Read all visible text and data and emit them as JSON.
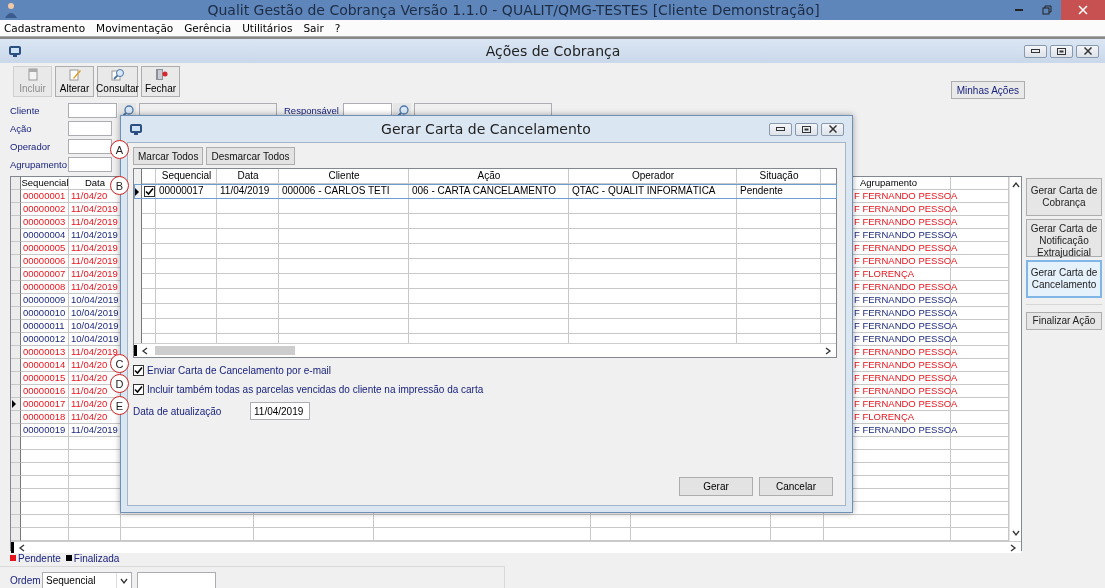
{
  "app": {
    "title": "Qualit Gestão de Cobrança Versão 1.1.0 - QUALIT/QMG-TESTES [Cliente Demonstração]"
  },
  "menu": [
    "Cadastramento",
    "Movimentação",
    "Gerência",
    "Utilitários",
    "Sair",
    "?"
  ],
  "window": {
    "title": "Ações de Cobrança"
  },
  "toolbar": [
    {
      "kind": "new",
      "label": "Incluir",
      "disabled": true
    },
    {
      "kind": "edit",
      "label": "Alterar",
      "disabled": false
    },
    {
      "kind": "search",
      "label": "Consultar",
      "disabled": false
    },
    {
      "kind": "close",
      "label": "Fechar",
      "disabled": false
    }
  ],
  "my_actions_button": "Minhas Ações",
  "filters": [
    {
      "label": "Cliente",
      "kind": "lookup"
    },
    {
      "label": "Responsável",
      "kind": "lookup"
    },
    {
      "label": "Ação",
      "kind": "plain"
    },
    {
      "label": "Operador",
      "kind": "plain"
    },
    {
      "label": "Agrupamento",
      "kind": "plain"
    }
  ],
  "grid": {
    "columns": [
      "Sequencial",
      "Data"
    ],
    "column_agrupamento": "Agrupamento",
    "rows": [
      {
        "sequencial": "00000001",
        "data": "11/04/20",
        "agrupamento": "F FERNANDO PESSOA",
        "pending": true,
        "current": false
      },
      {
        "sequencial": "00000002",
        "data": "11/04/2019",
        "agrupamento": "F FERNANDO PESSOA",
        "pending": true,
        "current": false
      },
      {
        "sequencial": "00000003",
        "data": "11/04/2019",
        "agrupamento": "F FERNANDO PESSOA",
        "pending": true,
        "current": false
      },
      {
        "sequencial": "00000004",
        "data": "11/04/2019",
        "agrupamento": "F FERNANDO PESSOA",
        "pending": false,
        "current": false
      },
      {
        "sequencial": "00000005",
        "data": "11/04/2019",
        "agrupamento": "F FERNANDO PESSOA",
        "pending": true,
        "current": false
      },
      {
        "sequencial": "00000006",
        "data": "11/04/2019",
        "agrupamento": "F FERNANDO PESSOA",
        "pending": true,
        "current": false
      },
      {
        "sequencial": "00000007",
        "data": "11/04/2019",
        "agrupamento": "F FLORENÇA",
        "pending": true,
        "current": false
      },
      {
        "sequencial": "00000008",
        "data": "11/04/2019",
        "agrupamento": "F FERNANDO PESSOA",
        "pending": true,
        "current": false
      },
      {
        "sequencial": "00000009",
        "data": "10/04/2019",
        "agrupamento": "F FERNANDO PESSOA",
        "pending": false,
        "current": false
      },
      {
        "sequencial": "00000010",
        "data": "10/04/2019",
        "agrupamento": "F FERNANDO PESSOA",
        "pending": false,
        "current": false
      },
      {
        "sequencial": "00000011",
        "data": "10/04/2019",
        "agrupamento": "F FERNANDO PESSOA",
        "pending": false,
        "current": false
      },
      {
        "sequencial": "00000012",
        "data": "10/04/2019",
        "agrupamento": "F FERNANDO PESSOA",
        "pending": false,
        "current": false
      },
      {
        "sequencial": "00000013",
        "data": "11/04/2019",
        "agrupamento": "F FERNANDO PESSOA",
        "pending": true,
        "current": false
      },
      {
        "sequencial": "00000014",
        "data": "11/04/20",
        "agrupamento": "F FERNANDO PESSOA",
        "pending": true,
        "current": false
      },
      {
        "sequencial": "00000015",
        "data": "11/04/20",
        "agrupamento": "F FERNANDO PESSOA",
        "pending": true,
        "current": false
      },
      {
        "sequencial": "00000016",
        "data": "11/04/20",
        "agrupamento": "F FERNANDO PESSOA",
        "pending": true,
        "current": false
      },
      {
        "sequencial": "00000017",
        "data": "11/04/20",
        "agrupamento": "F FERNANDO PESSOA",
        "pending": true,
        "current": true
      },
      {
        "sequencial": "00000018",
        "data": "11/04/20",
        "agrupamento": "F FLORENÇA",
        "pending": true,
        "current": false
      },
      {
        "sequencial": "00000019",
        "data": "11/04/2019",
        "agrupamento": "F FERNANDO PESSOA",
        "pending": false,
        "current": false
      }
    ]
  },
  "side_buttons": [
    {
      "label": "Gerar Carta de Cobrança",
      "focused": false
    },
    {
      "label": "Gerar Carta de Notificação Extrajudicial",
      "focused": false
    },
    {
      "label": "Gerar Carta de Cancelamento",
      "focused": true
    },
    {
      "label": "Finalizar Ação",
      "focused": false
    }
  ],
  "legend": [
    {
      "label": "Pendente",
      "color": "#e8141c"
    },
    {
      "label": "Finalizada",
      "color": "#000000"
    }
  ],
  "order": {
    "label": "Ordem",
    "value": "Sequencial"
  },
  "dialog": {
    "title": "Gerar Carta de Cancelamento",
    "buttons": [
      "Marcar Todos",
      "Desmarcar Todos"
    ],
    "columns": [
      "Sequencial",
      "Data",
      "Cliente",
      "Ação",
      "Operador",
      "Situação"
    ],
    "rows": [
      {
        "checked": true,
        "current": true,
        "cells": [
          "00000017",
          "11/04/2019",
          "000006 - CARLOS TETI",
          "006 - CARTA CANCELAMENTO",
          "QTAC - QUALIT INFORMÁTICA",
          "Pendente"
        ]
      }
    ],
    "options": [
      {
        "label": "Enviar Carta de Cancelamento por e-mail",
        "checked": true
      },
      {
        "label": "Incluir também todas as parcelas vencidas do cliente na impressão da carta",
        "checked": true
      }
    ],
    "date": {
      "label": "Data de atualização",
      "value": "11/04/2019"
    },
    "actions": [
      "Gerar",
      "Cancelar"
    ]
  },
  "annotations": [
    "A",
    "B",
    "C",
    "D",
    "E"
  ]
}
